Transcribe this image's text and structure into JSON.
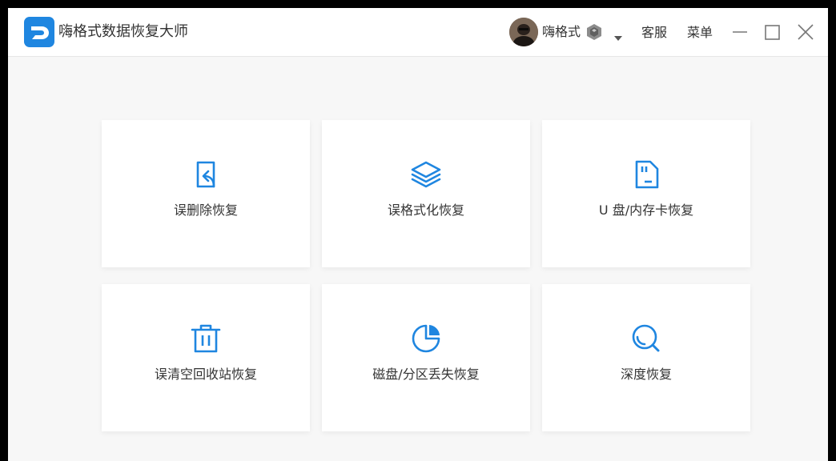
{
  "app": {
    "title": "嗨格式数据恢复大师",
    "logo_icon": "app-logo-icon"
  },
  "user": {
    "name": "嗨格式",
    "avatar_icon": "avatar-icon",
    "vip_icon": "vip-badge-icon",
    "dropdown_icon": "chevron-down-icon"
  },
  "header": {
    "service_label": "客服",
    "menu_label": "菜单"
  },
  "window_controls": [
    "minimize-icon",
    "maximize-icon",
    "close-icon"
  ],
  "colors": {
    "accent": "#1f86e0",
    "text": "#333333",
    "background": "#f7f7f7",
    "card": "#ffffff"
  },
  "cards": [
    {
      "label": "误删除恢复",
      "icon": "file-restore-icon"
    },
    {
      "label": "误格式化恢复",
      "icon": "layers-icon"
    },
    {
      "label": "U 盘/内存卡恢复",
      "icon": "sd-card-icon"
    },
    {
      "label": "误清空回收站恢复",
      "icon": "trash-icon"
    },
    {
      "label": "磁盘/分区丢失恢复",
      "icon": "pie-chart-icon"
    },
    {
      "label": "深度恢复",
      "icon": "search-icon"
    }
  ]
}
